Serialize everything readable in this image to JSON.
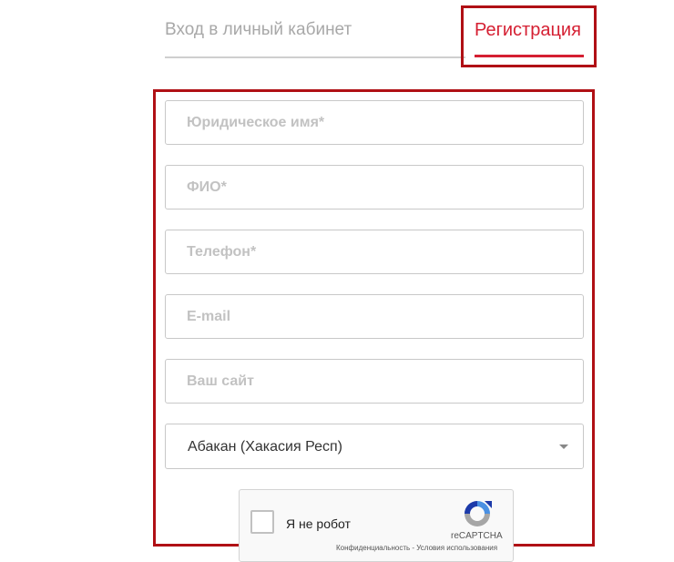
{
  "tabs": {
    "login_label": "Вход в личный кабинет",
    "register_label": "Регистрация"
  },
  "form": {
    "legal_name_placeholder": "Юридическое имя*",
    "full_name_placeholder": "ФИО*",
    "phone_placeholder": "Телефон*",
    "email_placeholder": "E-mail",
    "website_placeholder": "Ваш сайт",
    "city_selected": "Абакан (Хакасия Респ)"
  },
  "captcha": {
    "label": "Я не робот",
    "brand": "reCAPTCHA",
    "links": "Конфиденциальность - Условия использования"
  },
  "colors": {
    "accent": "#d51f32",
    "highlight_border": "#b01015"
  }
}
